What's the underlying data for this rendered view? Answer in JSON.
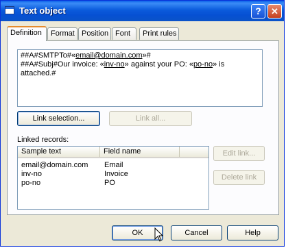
{
  "window": {
    "title": "Text object",
    "help_button": "?",
    "close_button": "✕"
  },
  "tabs": [
    {
      "label": "Definition",
      "active": true
    },
    {
      "label": "Format",
      "active": false
    },
    {
      "label": "Position",
      "active": false
    },
    {
      "label": "Font",
      "active": false
    },
    {
      "label": "Print rules",
      "active": false
    }
  ],
  "editor": {
    "line1": {
      "pre": "##A#SMTPTo#«",
      "field1": "email@domain.com",
      "post": "»#"
    },
    "line2": {
      "pre": "##A#Subj#Our invoice: «",
      "field1": "inv-no",
      "mid": "» against your PO: «",
      "field2": "po-no",
      "post": "» is attached.#"
    }
  },
  "buttons": {
    "link_selection": "Link selection...",
    "link_all": "Link all...",
    "edit_link": "Edit link...",
    "delete_link": "Delete link",
    "ok": "OK",
    "cancel": "Cancel",
    "help": "Help"
  },
  "linked_records": {
    "label": "Linked records:",
    "columns": [
      "Sample text",
      "Field name"
    ],
    "rows": [
      {
        "sample": "email@domain.com",
        "field": "Email"
      },
      {
        "sample": "inv-no",
        "field": "Invoice"
      },
      {
        "sample": "po-no",
        "field": "PO"
      }
    ]
  }
}
